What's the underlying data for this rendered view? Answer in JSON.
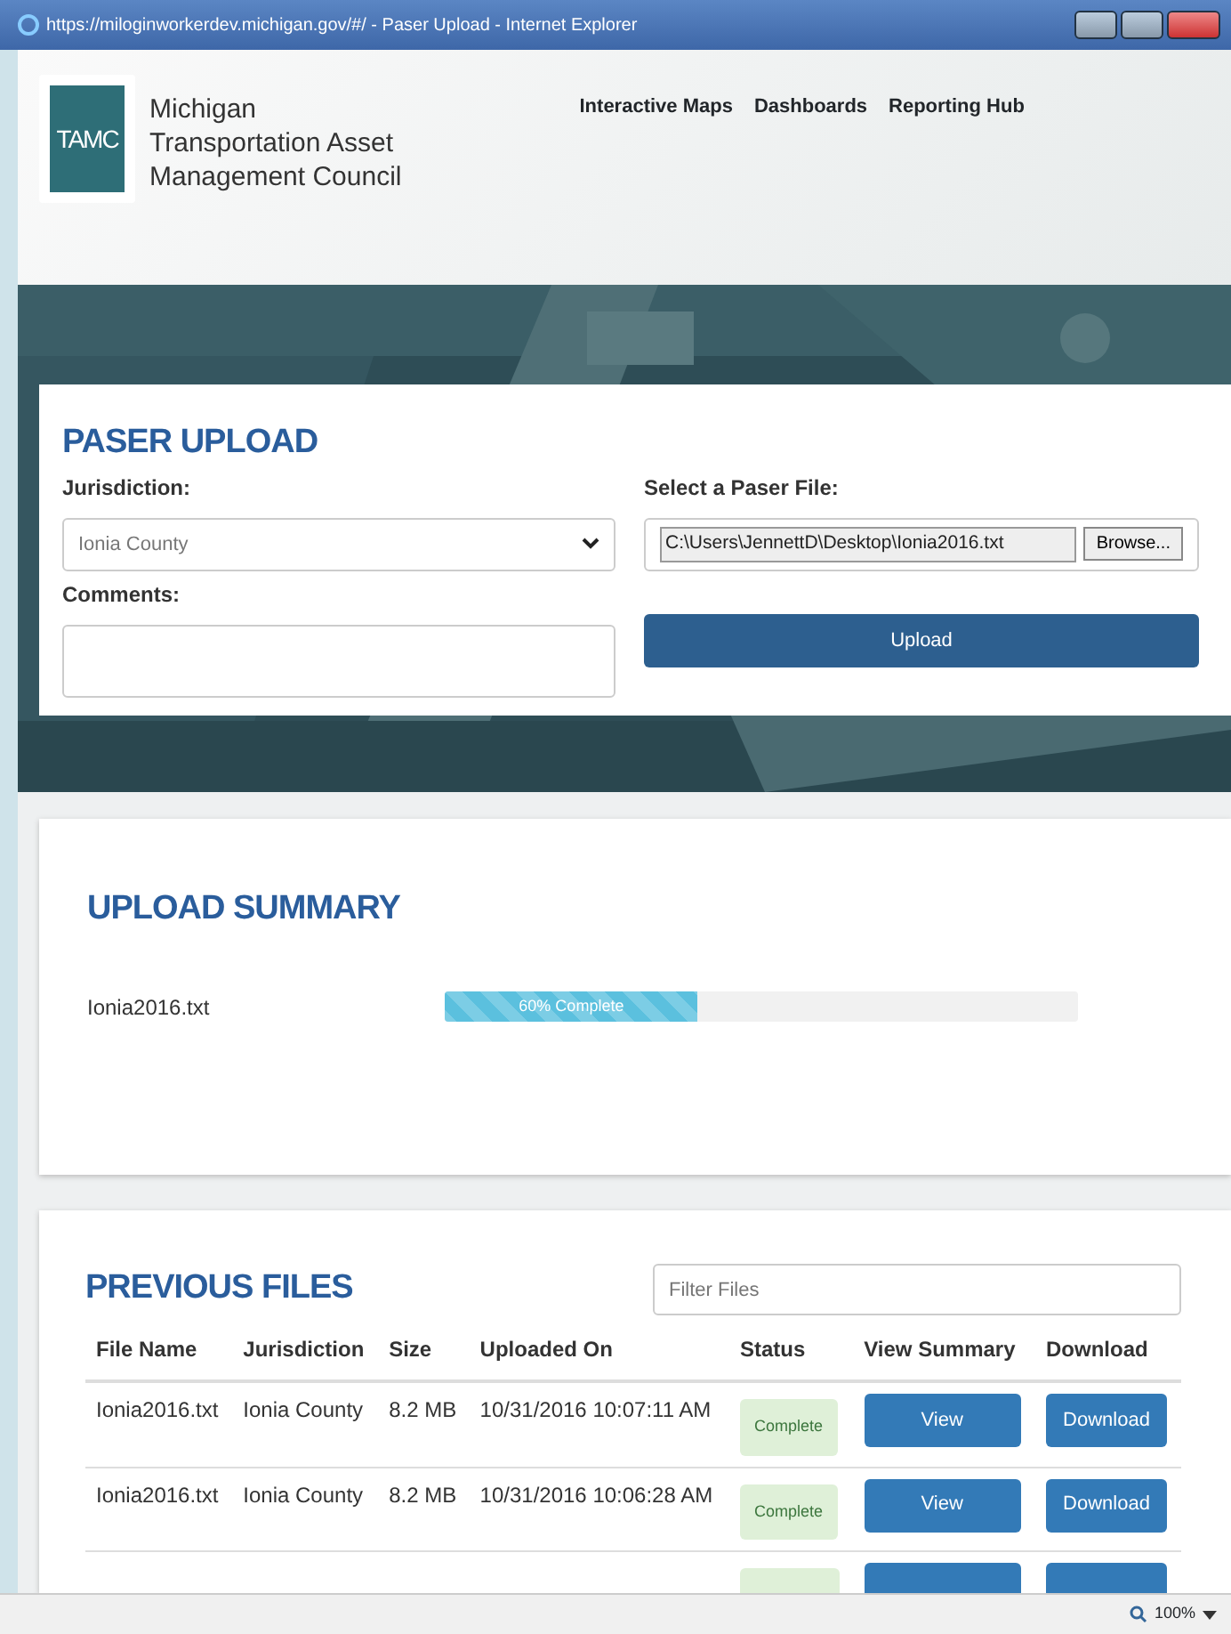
{
  "window": {
    "title": "https://miloginworkerdev.michigan.gov/#/ - Paser Upload - Internet Explorer"
  },
  "header": {
    "logo_text": "TAMC",
    "org_lines": [
      "Michigan",
      "Transportation Asset",
      "Management Council"
    ],
    "nav": [
      "Interactive Maps",
      "Dashboards",
      "Reporting Hub"
    ]
  },
  "upload_form": {
    "title": "PASER UPLOAD",
    "jurisdiction_label": "Jurisdiction:",
    "jurisdiction_value": "Ionia County",
    "comments_label": "Comments:",
    "file_label": "Select a Paser File:",
    "file_value": "C:\\Users\\JennettD\\Desktop\\Ionia2016.txt",
    "browse_button": "Browse...",
    "upload_button": "Upload"
  },
  "upload_summary": {
    "title": "UPLOAD SUMMARY",
    "items": [
      {
        "file": "Ionia2016.txt",
        "level": 0.4,
        "progress_label": "60% Complete"
      }
    ]
  },
  "previous_files": {
    "title": "PREVIOUS FILES",
    "filter": {
      "placeholder": "Filter Files"
    },
    "columns": [
      "File Name",
      "Jurisdiction",
      "Size",
      "Uploaded On",
      "Status",
      "View Summary",
      "Download"
    ],
    "rows": [
      {
        "file": "Ionia2016.txt",
        "jurisdiction": "Ionia County",
        "size": "8.2 MB",
        "uploaded": "10/31/2016 10:07:11 AM",
        "status": "Complete",
        "view": "View",
        "download": "Download"
      },
      {
        "file": "Ionia2016.txt",
        "jurisdiction": "Ionia County",
        "size": "8.2 MB",
        "uploaded": "10/31/2016 10:06:28 AM",
        "status": "Complete",
        "view": "View",
        "download": "Download"
      }
    ],
    "cut_off_rows": [
      {
        "kind": "cut_off"
      }
    ]
  },
  "status_bar": {
    "zoom": "100%"
  }
}
